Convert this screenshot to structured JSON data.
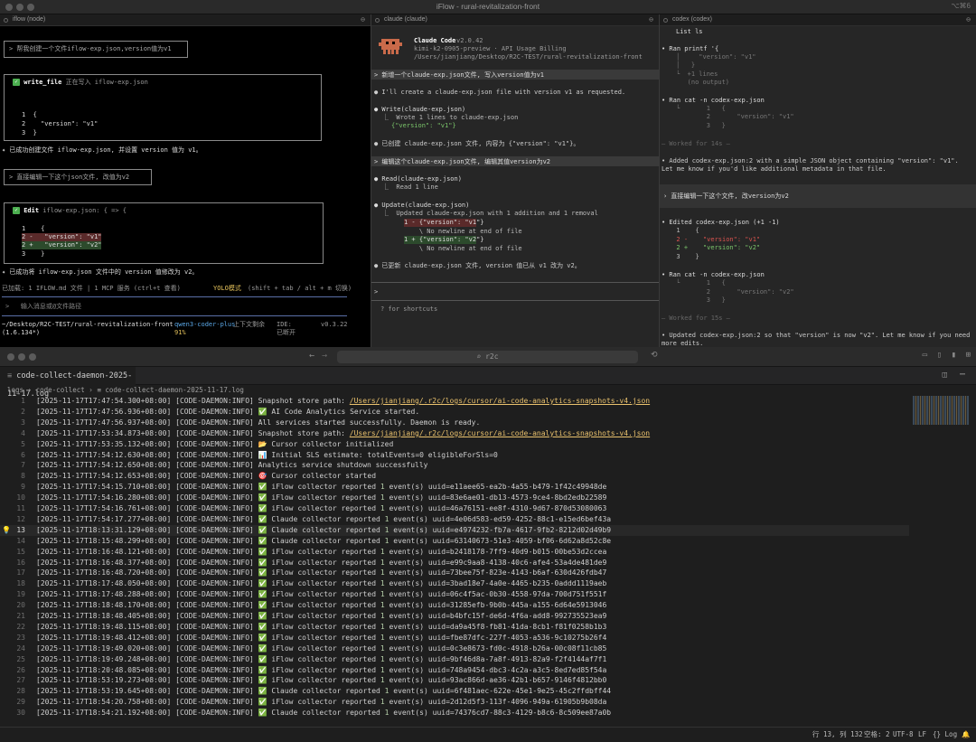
{
  "terminal": {
    "title": "iFlow - rural-revitalization-front",
    "shortcut": "⌥⌘6"
  },
  "iflow": {
    "pane_title": "iflow (node)",
    "prompt1": "> 帮我创建一个文件iflow-exp.json,version值为v1",
    "tool1_name": "write_file",
    "tool1_desc": "正在写入 iflow-exp.json",
    "tool1_lines": [
      "1  {",
      "2    \"version\": \"v1\"",
      "3  }"
    ],
    "result1": "✦ 已成功创建文件 iflow-exp.json, 并设置 version 值为 v1。",
    "prompt2": "> 直接编辑一下这个json文件, 改值为v2",
    "tool2_name": "Edit",
    "tool2_desc": "iflow-exp.json: { => {",
    "tool2_lines": [
      "1    {",
      "2 -   \"version\": \"v1\"",
      "2 +   \"version\": \"v2\"",
      "3    }"
    ],
    "result2": "✦ 已成功将 iflow-exp.json 文件中的 version 值修改为 v2。",
    "loaded": "已加载: 1 IFLOW.md 文件 | 1 MCP 服务 (ctrl+t 查看)",
    "yolo": "YOLO模式",
    "yolo_hint": "(shift + tab / alt + m 切换)",
    "input_placeholder": ">   输入消息或@文件路径",
    "status_path": "~/Desktop/R2C-TEST/rural-revitalization-front",
    "status_path2": "(1.6.134*)",
    "status_model": "qwen3-coder-plus",
    "status_ctx": "上下文剩余",
    "status_pct": "91%",
    "status_ide": "IDE:",
    "status_ide2": "已断开",
    "status_ver": "v0.3.22"
  },
  "claude": {
    "pane_title": "claude (claude)",
    "app_name": "Claude Code",
    "version": "v2.0.42",
    "model": "kimi-k2-0905-preview · API Usage Billing",
    "path": "/Users/jianjiang/Desktop/R2C-TEST/rural-revitalization-front",
    "prompt1": "> 新增一个claude-exp.json文件, 写入version值为v1",
    "msg1": "● I'll create a claude-exp.json file with version v1 as requested.",
    "write_call": "● Write(claude-exp.json)",
    "write_result": "⎿  Wrote 1 lines to claude-exp.json",
    "write_content": "{\"version\": \"v1\"}",
    "done1": "● 已创建 claude-exp.json 文件, 内容为 {\"version\": \"v1\"}。",
    "prompt2": "> 编辑这个claude-exp.json文件, 编辑其值version为v2",
    "read_call": "● Read(claude-exp.json)",
    "read_result": "⎿  Read 1 line",
    "update_call": "● Update(claude-exp.json)",
    "update_result": "⎿  Updated claude-exp.json with 1 addition and 1 removal",
    "diff": [
      "1 - {\"version\": \"v1\"}",
      "    \\ No newline at end of file",
      "1 + {\"version\": \"v2\"}",
      "    \\ No newline at end of file"
    ],
    "done2": "● 已更新 claude-exp.json 文件, version 值已从 v1 改为 v2。",
    "input_prompt": ">",
    "shortcuts": "? for shortcuts"
  },
  "codex": {
    "pane_title": "codex (codex)",
    "list_cmd": "List ls",
    "ran1": "• Ran printf '{",
    "ran1_lines": [
      "│     \"version\": \"v1\"",
      "│   }",
      "└  +1 lines",
      "   (no output)"
    ],
    "ran2": "• Ran cat -n codex-exp.json",
    "ran2_lines": [
      "└       1   {",
      "        2       \"version\": \"v1\"",
      "        3   }"
    ],
    "worked1": "— Worked for 14s —",
    "added_msg": "• Added codex-exp.json:2 with a simple JSON object containing \"version\": \"v1\". Let me know if you'd like additional metadata in that file.",
    "prompt": "› 直接编辑一下这个文件, 改version为v2",
    "edited": "• Edited codex-exp.json (+1 -1)",
    "edited_lines": [
      "  1    {",
      "  2 -    \"version\": \"v1\"",
      "  2 +    \"version\": \"v2\"",
      "  3    }"
    ],
    "ran3": "• Ran cat -n codex-exp.json",
    "ran3_lines": [
      "└       1   {",
      "        2       \"version\": \"v2\"",
      "        3   }"
    ],
    "worked2": "— Worked for 15s —",
    "updated_msg": "• Updated codex-exp.json:2 so that \"version\" is now \"v2\". Let me know if you need more edits."
  },
  "editor": {
    "search": "⌕ r2c",
    "tab": "code-collect-daemon-2025-11-17.log",
    "breadcrumb": "logs  ›  code-collect  ›  ≡  code-collect-daemon-2025-11-17.log",
    "status_pos": "行 13, 列 132",
    "status_spaces": "空格: 2",
    "status_enc": "UTF-8",
    "status_eol": "LF",
    "status_lang": "{} Log",
    "lines": [
      [
        "[2025-11-17T17:47:54.300+08:00] [CODE-DAEMON:INFO] Snapshot store path: ",
        "/Users/jianjiang/.r2c/logs/cursor/ai-code-analytics-snapshots-v4.json"
      ],
      [
        "[2025-11-17T17:47:56.936+08:00] [CODE-DAEMON:INFO] ✅ AI Code Analytics Service started.",
        ""
      ],
      [
        "[2025-11-17T17:47:56.937+08:00] [CODE-DAEMON:INFO] All services started successfully. Daemon is ready.",
        ""
      ],
      [
        "[2025-11-17T17:53:34.873+08:00] [CODE-DAEMON:INFO] Snapshot store path: ",
        "/Users/jianjiang/.r2c/logs/cursor/ai-code-analytics-snapshots-v4.json"
      ],
      [
        "[2025-11-17T17:53:35.132+08:00] [CODE-DAEMON:INFO] 📂 Cursor collector initialized",
        ""
      ],
      [
        "[2025-11-17T17:54:12.630+08:00] [CODE-DAEMON:INFO] 📊 Initial SLS estimate: totalEvents=0 eligibleForSls=0",
        ""
      ],
      [
        "[2025-11-17T17:54:12.650+08:00] [CODE-DAEMON:INFO] Analytics service shutdown successfully",
        ""
      ],
      [
        "[2025-11-17T17:54:12.653+08:00] [CODE-DAEMON:INFO] 🎯 Cursor collector started",
        ""
      ],
      [
        "[2025-11-17T17:54:15.710+08:00] [CODE-DAEMON:INFO] ✅ iFlow collector reported 1 event(s) uuid=e11aee65-ea2b-4a55-b479-1f42c49948de",
        ""
      ],
      [
        "[2025-11-17T17:54:16.280+08:00] [CODE-DAEMON:INFO] ✅ iFlow collector reported 1 event(s) uuid=83e6ae01-db13-4573-9ce4-8bd2edb22589",
        ""
      ],
      [
        "[2025-11-17T17:54:16.761+08:00] [CODE-DAEMON:INFO] ✅ iFlow collector reported 1 event(s) uuid=46a76151-ee8f-4310-9d67-870d53080063",
        ""
      ],
      [
        "[2025-11-17T17:54:17.277+08:00] [CODE-DAEMON:INFO] ✅ Claude collector reported 1 event(s) uuid=4e06d583-ed59-4252-88c1-e15ed6bef43a",
        ""
      ],
      [
        "[2025-11-17T18:13:31.129+08:00] [CODE-DAEMON:INFO] ✅ Claude collector reported 1 event(s) uuid=e4974232-fb7a-4617-9fb2-8212d02d49b9",
        ""
      ],
      [
        "[2025-11-17T18:15:48.299+08:00] [CODE-DAEMON:INFO] ✅ Claude collector reported 1 event(s) uuid=63140673-51e3-4059-bf06-6d62a8d52c8e",
        ""
      ],
      [
        "[2025-11-17T18:16:48.121+08:00] [CODE-DAEMON:INFO] ✅ iFlow collector reported 1 event(s) uuid=b2418178-7ff9-40d9-b015-00be53d2ccea",
        ""
      ],
      [
        "[2025-11-17T18:16:48.377+08:00] [CODE-DAEMON:INFO] ✅ iFlow collector reported 1 event(s) uuid=e99c9aa8-4138-40c6-afe4-53a4de481de9",
        ""
      ],
      [
        "[2025-11-17T18:16:48.720+08:00] [CODE-DAEMON:INFO] ✅ iFlow collector reported 1 event(s) uuid=73bee75f-823e-4143-b6af-630d426fdb47",
        ""
      ],
      [
        "[2025-11-17T18:17:48.050+08:00] [CODE-DAEMON:INFO] ✅ iFlow collector reported 1 event(s) uuid=3bad18e7-4a0e-4465-b235-0addd1119aeb",
        ""
      ],
      [
        "[2025-11-17T18:17:48.288+08:00] [CODE-DAEMON:INFO] ✅ iFlow collector reported 1 event(s) uuid=06c4f5ac-0b30-4558-97da-700d751f551f",
        ""
      ],
      [
        "[2025-11-17T18:18:48.170+08:00] [CODE-DAEMON:INFO] ✅ iFlow collector reported 1 event(s) uuid=31285efb-9b0b-445a-a155-6d64e5913046",
        ""
      ],
      [
        "[2025-11-17T18:18:48.405+08:00] [CODE-DAEMON:INFO] ✅ iFlow collector reported 1 event(s) uuid=b4bfc15f-de6d-4f6a-add8-992735523ea9",
        ""
      ],
      [
        "[2025-11-17T18:19:48.115+08:00] [CODE-DAEMON:INFO] ✅ iFlow collector reported 1 event(s) uuid=da9a45f8-fb81-41da-8cb1-f81f0258b1b3",
        ""
      ],
      [
        "[2025-11-17T18:19:48.412+08:00] [CODE-DAEMON:INFO] ✅ iFlow collector reported 1 event(s) uuid=fbe87dfc-227f-4053-a536-9c10275b26f4",
        ""
      ],
      [
        "[2025-11-17T18:19:49.020+08:00] [CODE-DAEMON:INFO] ✅ iFlow collector reported 1 event(s) uuid=0c3e8673-fd0c-4918-b26a-00c08f11cb85",
        ""
      ],
      [
        "[2025-11-17T18:19:49.248+08:00] [CODE-DAEMON:INFO] ✅ iFlow collector reported 1 event(s) uuid=9bf46d8a-7a8f-4913-82a9-f2f4144af7f1",
        ""
      ],
      [
        "[2025-11-17T18:20:48.085+08:00] [CODE-DAEMON:INFO] ✅ iFlow collector reported 1 event(s) uuid=748a9454-dbc3-4c2a-a3c5-8ed7ed85f54a",
        ""
      ],
      [
        "[2025-11-17T18:53:19.273+08:00] [CODE-DAEMON:INFO] ✅ iFlow collector reported 1 event(s) uuid=93ac866d-ae36-42b1-b657-9146f4812bb0",
        ""
      ],
      [
        "[2025-11-17T18:53:19.645+08:00] [CODE-DAEMON:INFO] ✅ Claude collector reported 1 event(s) uuid=6f481aec-622e-45e1-9e25-45c2ffdbff44",
        ""
      ],
      [
        "[2025-11-17T18:54:20.758+08:00] [CODE-DAEMON:INFO] ✅ iFlow collector reported 1 event(s) uuid=2d12d5f3-113f-4096-949a-61905b9b08da",
        ""
      ],
      [
        "[2025-11-17T18:54:21.192+08:00] [CODE-DAEMON:INFO] ✅ Claude collector reported 1 event(s) uuid=74376cd7-88c3-4129-b8c6-8c509ee87a0b",
        ""
      ]
    ]
  }
}
